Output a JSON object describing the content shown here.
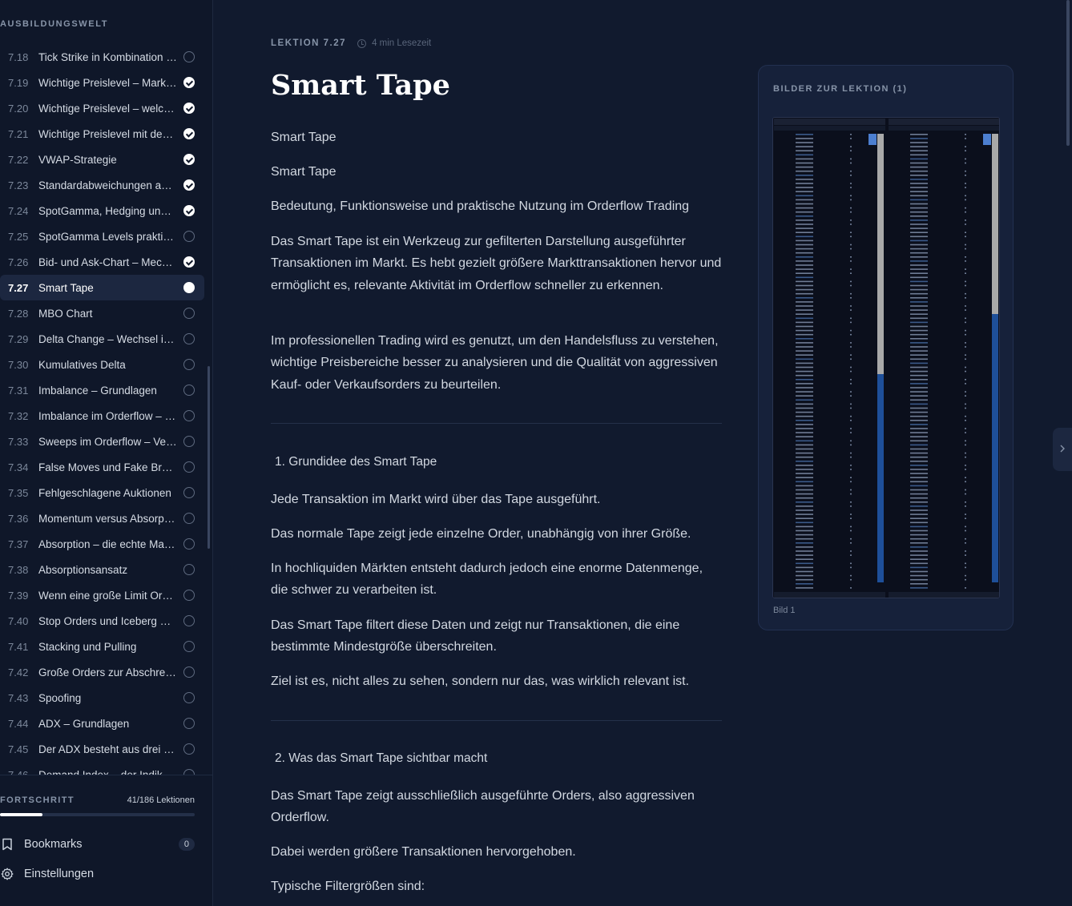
{
  "sidebar": {
    "title": "AUSBILDUNGSWELT",
    "lessons": [
      {
        "num": "7.18",
        "title": "Tick Strike in Kombination mit Orderflow",
        "status": "open"
      },
      {
        "num": "7.19",
        "title": "Wichtige Preislevel – Markt verstehen",
        "status": "done"
      },
      {
        "num": "7.20",
        "title": "Wichtige Preislevel – welche Level zählen",
        "status": "done"
      },
      {
        "num": "7.21",
        "title": "Wichtige Preislevel mit dem Orderflow",
        "status": "done"
      },
      {
        "num": "7.22",
        "title": "VWAP-Strategie",
        "status": "done"
      },
      {
        "num": "7.23",
        "title": "Standardabweichungen am VWAP",
        "status": "done"
      },
      {
        "num": "7.24",
        "title": "SpotGamma, Hedging und Optionen",
        "status": "done"
      },
      {
        "num": "7.25",
        "title": "SpotGamma Levels praktisch nutzen",
        "status": "open"
      },
      {
        "num": "7.26",
        "title": "Bid- und Ask-Chart – Mechanik",
        "status": "done"
      },
      {
        "num": "7.27",
        "title": "Smart Tape",
        "status": "current"
      },
      {
        "num": "7.28",
        "title": "MBO Chart",
        "status": "open"
      },
      {
        "num": "7.29",
        "title": "Delta Change – Wechsel im Delta",
        "status": "open"
      },
      {
        "num": "7.30",
        "title": "Kumulatives Delta",
        "status": "open"
      },
      {
        "num": "7.31",
        "title": "Imbalance – Grundlagen",
        "status": "open"
      },
      {
        "num": "7.32",
        "title": "Imbalance im Orderflow – Praxis",
        "status": "open"
      },
      {
        "num": "7.33",
        "title": "Sweeps im Orderflow – Verständnis",
        "status": "open"
      },
      {
        "num": "7.34",
        "title": "False Moves und Fake Breakouts",
        "status": "open"
      },
      {
        "num": "7.35",
        "title": "Fehlgeschlagene Auktionen",
        "status": "open"
      },
      {
        "num": "7.36",
        "title": "Momentum versus Absorption",
        "status": "open"
      },
      {
        "num": "7.37",
        "title": "Absorption – die echte Marktkraft",
        "status": "open"
      },
      {
        "num": "7.38",
        "title": "Absorptionsansatz",
        "status": "open"
      },
      {
        "num": "7.39",
        "title": "Wenn eine große Limit Order",
        "status": "open"
      },
      {
        "num": "7.40",
        "title": "Stop Orders und Iceberg Orders",
        "status": "open"
      },
      {
        "num": "7.41",
        "title": "Stacking und Pulling",
        "status": "open"
      },
      {
        "num": "7.42",
        "title": "Große Orders zur Abschreckung",
        "status": "open"
      },
      {
        "num": "7.43",
        "title": "Spoofing",
        "status": "open"
      },
      {
        "num": "7.44",
        "title": "ADX – Grundlagen",
        "status": "open"
      },
      {
        "num": "7.45",
        "title": "Der ADX besteht aus drei Linien",
        "status": "open"
      },
      {
        "num": "7.46",
        "title": "Demand Index – der Indikator",
        "status": "open"
      }
    ],
    "progress": {
      "label": "FORTSCHRITT",
      "count": "41/186 Lektionen",
      "fraction": 0.22
    },
    "bookmarks": {
      "label": "Bookmarks",
      "count": "0",
      "icon": "bookmark-icon"
    },
    "settings": {
      "label": "Einstellungen",
      "icon": "gear-icon"
    }
  },
  "lesson": {
    "label": "LEKTION 7.27",
    "read_time": "4 min Lesezeit",
    "title": "Smart Tape",
    "p1": "Smart Tape",
    "p2": "Smart Tape",
    "p3": "Bedeutung, Funktionsweise und praktische Nutzung im Orderflow Trading",
    "p4": "Das Smart Tape ist ein Werkzeug zur gefilterten Darstellung ausgeführter Transaktionen im Markt. Es hebt gezielt größere Markttransaktionen hervor und ermöglicht es, relevante Aktivität im Orderflow schneller zu erkennen.",
    "p5": "Im professionellen Trading wird es genutzt, um den Handelsfluss zu verstehen, wichtige Preisbereiche besser zu analysieren und die Qualität von aggressiven Kauf- oder Verkaufsorders zu beurteilen.",
    "h1": "1. Grundidee des Smart Tape",
    "p6": "Jede Transaktion im Markt wird über das Tape ausgeführt.",
    "p7": "Das normale Tape zeigt jede einzelne Order, unabhängig von ihrer Größe.",
    "p8": "In hochliquiden Märkten entsteht dadurch jedoch eine enorme Datenmenge, die schwer zu verarbeiten ist.",
    "p9": "Das Smart Tape filtert diese Daten und zeigt nur Transaktionen, die eine bestimmte Mindestgröße überschreiten.",
    "p10": "Ziel ist es, nicht alles zu sehen, sondern nur das, was wirklich relevant ist.",
    "h2": "2. Was das Smart Tape sichtbar macht",
    "p11": "Das Smart Tape zeigt ausschließlich ausgeführte Orders, also aggressiven Orderflow.",
    "p12": "Dabei werden größere Transaktionen hervorgehoben.",
    "p13": "Typische Filtergrößen sind:"
  },
  "images": {
    "title": "BILDER ZUR LEKTION (1)",
    "caption": "Bild 1"
  }
}
